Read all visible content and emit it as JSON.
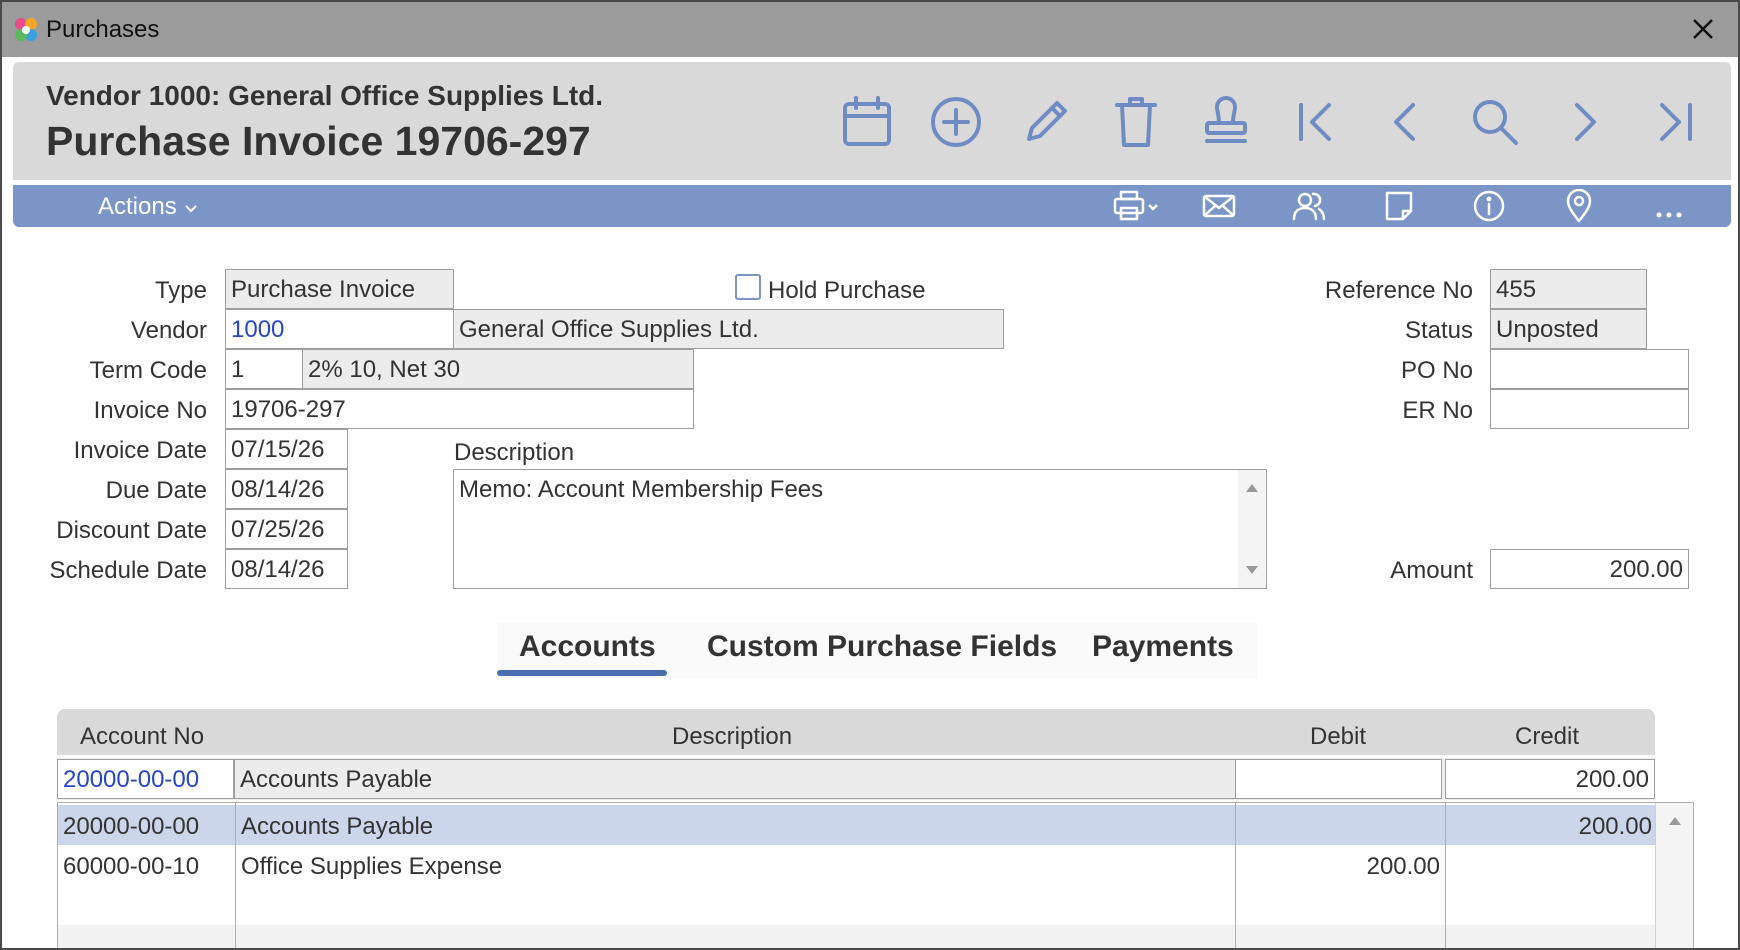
{
  "window": {
    "title": "Purchases"
  },
  "header": {
    "vendor_line": "Vendor 1000: General Office Supplies Ltd.",
    "doc_title": "Purchase Invoice 19706-297",
    "icons": [
      "calendar-icon",
      "add-circle-icon",
      "pencil-icon",
      "trash-icon",
      "stamp-icon",
      "first-record-icon",
      "previous-icon",
      "search-icon",
      "next-icon",
      "last-record-icon"
    ]
  },
  "toolbar": {
    "actions_label": "Actions",
    "icons": [
      "printer-icon",
      "mail-icon",
      "people-icon",
      "note-icon",
      "info-icon",
      "location-icon",
      "more-icon"
    ]
  },
  "form": {
    "type_label": "Type",
    "type_value": "Purchase Invoice",
    "vendor_label": "Vendor",
    "vendor_code": "1000",
    "vendor_name": "General Office Supplies Ltd.",
    "term_label": "Term Code",
    "term_code": "1",
    "term_desc": "2% 10, Net 30",
    "invoice_no_label": "Invoice No",
    "invoice_no": "19706-297",
    "invoice_date_label": "Invoice Date",
    "invoice_date": "07/15/26",
    "due_date_label": "Due Date",
    "due_date": "08/14/26",
    "discount_date_label": "Discount Date",
    "discount_date": "07/25/26",
    "schedule_date_label": "Schedule Date",
    "schedule_date": "08/14/26",
    "hold_label": "Hold Purchase",
    "hold_checked": false,
    "description_label": "Description",
    "description": "Memo: Account Membership Fees",
    "reference_label": "Reference No",
    "reference_no": "455",
    "status_label": "Status",
    "status": "Unposted",
    "po_label": "PO No",
    "po_no": "",
    "er_label": "ER No",
    "er_no": "",
    "amount_label": "Amount",
    "amount": "200.00"
  },
  "tabs": [
    {
      "label": "Accounts",
      "active": true
    },
    {
      "label": "Custom Purchase Fields",
      "active": false
    },
    {
      "label": "Payments",
      "active": false
    }
  ],
  "grid": {
    "columns": [
      "Account No",
      "Description",
      "Debit",
      "Credit"
    ],
    "edit_row": {
      "account": "20000-00-00",
      "description": "Accounts Payable",
      "debit": "",
      "credit": "200.00"
    },
    "rows": [
      {
        "account": "20000-00-00",
        "description": "Accounts Payable",
        "debit": "",
        "credit": "200.00"
      },
      {
        "account": "60000-00-10",
        "description": "Office Supplies Expense",
        "debit": "200.00",
        "credit": ""
      }
    ]
  },
  "colors": {
    "accent": "#7b96c6",
    "link": "#2745c9",
    "selected_row": "#ccd6ea",
    "titlebar": "#9b9b9b"
  }
}
